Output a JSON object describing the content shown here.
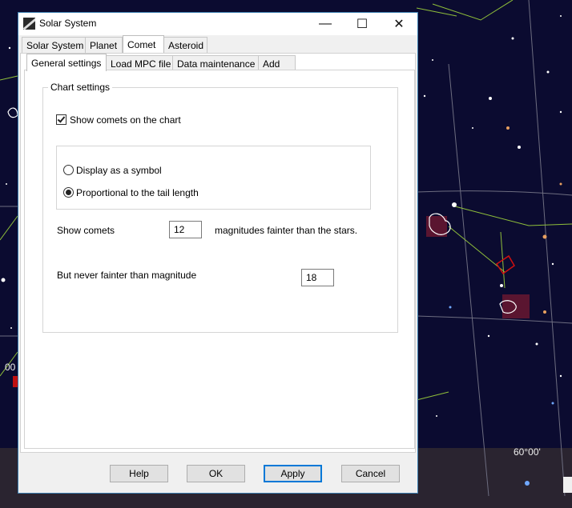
{
  "window": {
    "title": "Solar System"
  },
  "titlebar": {
    "minimize": "—",
    "maximize": "☐",
    "close": "✕"
  },
  "main_tabs": [
    "Solar System",
    "Planet",
    "Comet",
    "Asteroid"
  ],
  "sub_tabs": [
    "General settings",
    "Load MPC file",
    "Data maintenance",
    "Add"
  ],
  "chart_settings": {
    "group_label": "Chart settings",
    "show_comets_checkbox": "Show comets on the chart",
    "show_comets_checked": true,
    "radio_symbol": "Display as a symbol",
    "radio_proportional": "Proportional to the tail length",
    "selected_mode": "proportional",
    "show_comets_label": "Show comets",
    "magnitude_offset": "12",
    "fainter_suffix": "magnitudes fainter than the stars.",
    "never_fainter_label": "But never fainter than magnitude",
    "limit_magnitude": "18"
  },
  "buttons": {
    "help": "Help",
    "ok": "OK",
    "apply": "Apply",
    "cancel": "Cancel"
  },
  "background": {
    "label_left": "00",
    "label_coord": "60°00'"
  }
}
